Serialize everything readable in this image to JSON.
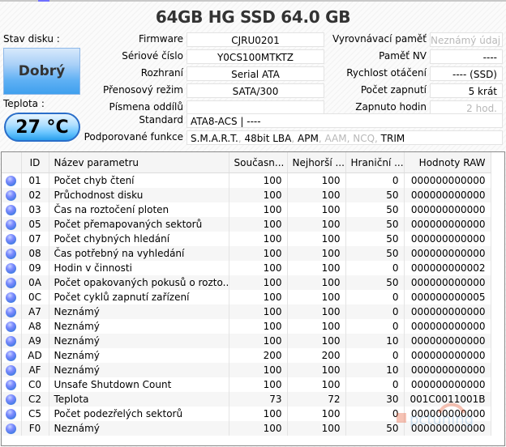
{
  "title": "64GB HG SSD  64.0 GB",
  "status": {
    "label": "Stav disku :",
    "value": "Dobrý"
  },
  "temperature": {
    "label": "Teplota :",
    "value": "27 °C"
  },
  "info_left": [
    {
      "key": "firmware",
      "label": "Firmware",
      "value": "CJRU0201"
    },
    {
      "key": "serial",
      "label": "Sériové číslo",
      "value": "Y0CS100MTKTZ"
    },
    {
      "key": "interface",
      "label": "Rozhraní",
      "value": "Serial ATA"
    },
    {
      "key": "transfer",
      "label": "Přenosový režim",
      "value": "SATA/300"
    },
    {
      "key": "letters",
      "label": "Písmena oddílů",
      "value": ""
    }
  ],
  "info_right": [
    {
      "key": "cache",
      "label": "Vyrovnávací paměť",
      "value": "Neznámý údaj",
      "dim": true
    },
    {
      "key": "nv",
      "label": "Paměť NV",
      "value": "----",
      "dim": false
    },
    {
      "key": "rpm",
      "label": "Rychlost otáčení",
      "value": "---- (SSD)",
      "dim": false
    },
    {
      "key": "power_count",
      "label": "Počet zapnutí",
      "value": "5 krát",
      "dim": false
    },
    {
      "key": "power_hours",
      "label": "Zapnuto hodin",
      "value": "2 hod.",
      "dim": true
    }
  ],
  "standard": {
    "label": "Standard",
    "value": "ATA8-ACS | ----"
  },
  "features": {
    "label": "Podporované funkce",
    "items": [
      {
        "text": "S.M.A.R.T.",
        "enabled": true
      },
      {
        "text": "48bit LBA",
        "enabled": true
      },
      {
        "text": "APM",
        "enabled": true
      },
      {
        "text": "AAM",
        "enabled": false
      },
      {
        "text": "NCQ",
        "enabled": false
      },
      {
        "text": "TRIM",
        "enabled": true
      }
    ]
  },
  "smart_table": {
    "columns": [
      "",
      "ID",
      "Název parametru",
      "Současn...",
      "Nejhorší ...",
      "Hraniční ...",
      "Hodnoty RAW"
    ],
    "rows": [
      [
        "01",
        "Počet chyb čtení",
        "100",
        "100",
        "0",
        "000000000000"
      ],
      [
        "02",
        "Průchodnost disku",
        "100",
        "100",
        "50",
        "000000000000"
      ],
      [
        "03",
        "Čas na roztočení ploten",
        "100",
        "100",
        "50",
        "000000000000"
      ],
      [
        "05",
        "Počet přemapovaných sektorů",
        "100",
        "100",
        "50",
        "000000000000"
      ],
      [
        "07",
        "Počet chybných hledání",
        "100",
        "100",
        "50",
        "000000000000"
      ],
      [
        "08",
        "Čas potřebný na vyhledání",
        "100",
        "100",
        "50",
        "000000000000"
      ],
      [
        "09",
        "Hodin v činnosti",
        "100",
        "100",
        "0",
        "000000000002"
      ],
      [
        "0A",
        "Počet opakovaných pokusů o rozto...",
        "100",
        "100",
        "50",
        "000000000000"
      ],
      [
        "0C",
        "Počet cyklů zapnutí zařízení",
        "100",
        "100",
        "0",
        "000000000005"
      ],
      [
        "A7",
        "Neznámý",
        "100",
        "100",
        "0",
        "000000000000"
      ],
      [
        "A8",
        "Neznámý",
        "100",
        "100",
        "0",
        "000000000000"
      ],
      [
        "A9",
        "Neznámý",
        "100",
        "100",
        "10",
        "000000000000"
      ],
      [
        "AD",
        "Neznámý",
        "200",
        "200",
        "0",
        "000000000000"
      ],
      [
        "AF",
        "Neznámý",
        "100",
        "100",
        "10",
        "000000000000"
      ],
      [
        "C0",
        "Unsafe Shutdown Count",
        "100",
        "100",
        "0",
        "000000000000"
      ],
      [
        "C2",
        "Teplota",
        "73",
        "72",
        "30",
        "001C0011001B"
      ],
      [
        "C5",
        "Počet podezřelých sektorů",
        "100",
        "100",
        "0",
        "000000000000"
      ],
      [
        "F0",
        "Neznámý",
        "100",
        "100",
        "50",
        "000000000000"
      ]
    ]
  },
  "watermark": "pctuning"
}
